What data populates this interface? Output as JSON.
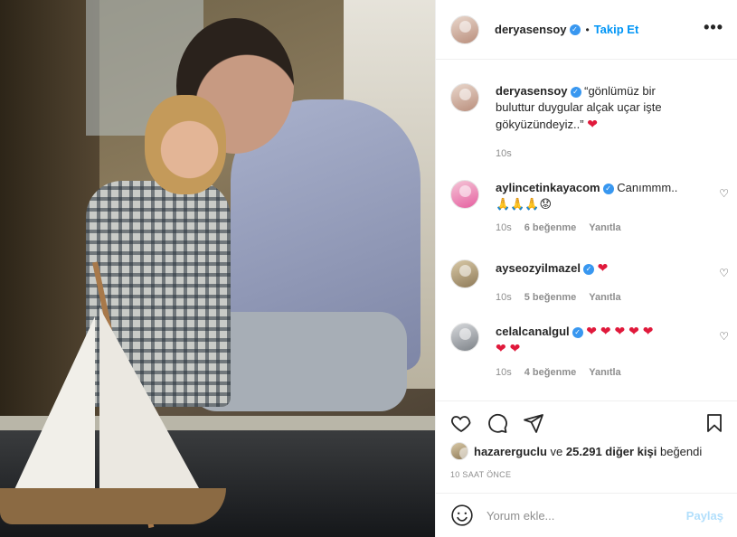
{
  "header": {
    "username": "deryasensoy",
    "separator": "•",
    "follow_label": "Takip Et",
    "more_label": "•••"
  },
  "caption": {
    "username": "deryasensoy",
    "text": "“gönlümüz bir buluttur duygular alçak uçar işte gökyüzündeyiz..”",
    "time": "10s"
  },
  "comments": [
    {
      "username": "aylincetinkayacom",
      "text": "Canımmm..",
      "emoji": "🙏🙏🙏😟",
      "time": "10s",
      "likes": "6 beğenme",
      "reply": "Yanıtla"
    },
    {
      "username": "ayseozyilmazel",
      "text": "",
      "emoji": "",
      "time": "10s",
      "likes": "5 beğenme",
      "reply": "Yanıtla"
    },
    {
      "username": "celalcanalgul",
      "text": "",
      "emoji": "",
      "time": "10s",
      "likes": "4 beğenme",
      "reply": "Yanıtla"
    }
  ],
  "likes": {
    "liker": "hazarerguclu",
    "connector": "ve",
    "others": "25.291 diğer kişi",
    "suffix": "beğendi"
  },
  "time_ago": "10 SAAT ÖNCE",
  "comment_box": {
    "placeholder": "Yorum ekle...",
    "post_label": "Paylaş"
  },
  "colors": {
    "accent": "#0095f6",
    "heart": "#e0193b",
    "muted": "#8e8e8e",
    "post_disabled": "#b2dffc"
  }
}
